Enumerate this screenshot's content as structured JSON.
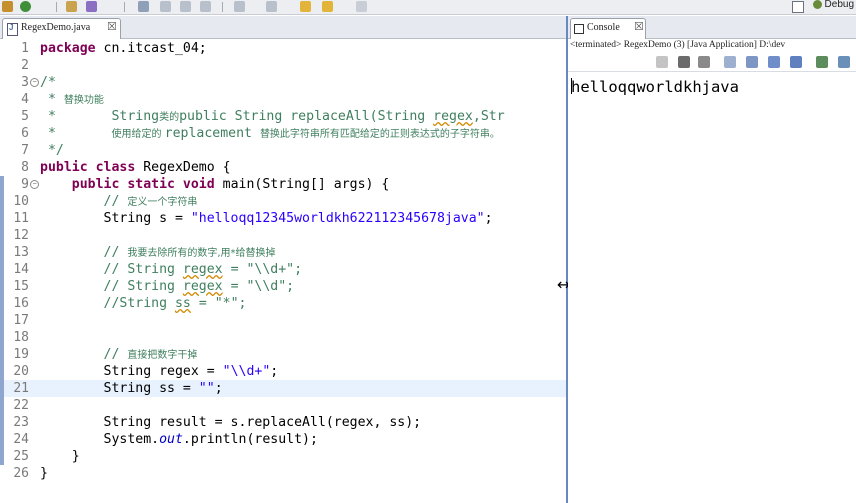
{
  "editor": {
    "tab_label": "RegexDemo.java",
    "close_glyph": "☒",
    "current_line": 21,
    "lines": [
      {
        "n": "1",
        "mark": false,
        "fold": "",
        "tokens": [
          {
            "t": "package",
            "c": "kw"
          },
          {
            "t": " cn.itcast_04;",
            "c": ""
          }
        ]
      },
      {
        "n": "2",
        "mark": false,
        "fold": "",
        "tokens": []
      },
      {
        "n": "3",
        "mark": false,
        "fold": "−",
        "tokens": [
          {
            "t": "/*",
            "c": "cm"
          }
        ]
      },
      {
        "n": "4",
        "mark": false,
        "fold": "",
        "tokens": [
          {
            "t": " * ",
            "c": "cm"
          },
          {
            "t": "替换功能",
            "c": "cmc"
          }
        ]
      },
      {
        "n": "5",
        "mark": false,
        "fold": "",
        "tokens": [
          {
            "t": " *       String",
            "c": "cm"
          },
          {
            "t": "类的",
            "c": "cmc"
          },
          {
            "t": "public String replaceAll(String ",
            "c": "cm"
          },
          {
            "t": "regex",
            "c": "cm sq"
          },
          {
            "t": ",Str",
            "c": "cm"
          }
        ]
      },
      {
        "n": "6",
        "mark": false,
        "fold": "",
        "tokens": [
          {
            "t": " *       ",
            "c": "cm"
          },
          {
            "t": "使用给定的 ",
            "c": "cmc"
          },
          {
            "t": "replacement ",
            "c": "cm"
          },
          {
            "t": "替换此字符串所有匹配给定的正则表达式的子字符串。",
            "c": "cmc"
          }
        ]
      },
      {
        "n": "7",
        "mark": false,
        "fold": "",
        "tokens": [
          {
            "t": " */",
            "c": "cm"
          }
        ]
      },
      {
        "n": "8",
        "mark": false,
        "fold": "",
        "tokens": [
          {
            "t": "public class",
            "c": "kw"
          },
          {
            "t": " RegexDemo {",
            "c": ""
          }
        ]
      },
      {
        "n": "9",
        "mark": true,
        "fold": "−",
        "tokens": [
          {
            "t": "    ",
            "c": ""
          },
          {
            "t": "public static void",
            "c": "kw"
          },
          {
            "t": " main(String[] args) {",
            "c": ""
          }
        ]
      },
      {
        "n": "10",
        "mark": true,
        "fold": "",
        "tokens": [
          {
            "t": "        // ",
            "c": "cm"
          },
          {
            "t": "定义一个字符串",
            "c": "cmc"
          }
        ]
      },
      {
        "n": "11",
        "mark": true,
        "fold": "",
        "tokens": [
          {
            "t": "        String s = ",
            "c": ""
          },
          {
            "t": "\"helloqq12345worldkh622112345678java\"",
            "c": "st"
          },
          {
            "t": ";",
            "c": ""
          }
        ]
      },
      {
        "n": "12",
        "mark": true,
        "fold": "",
        "tokens": []
      },
      {
        "n": "13",
        "mark": true,
        "fold": "",
        "tokens": [
          {
            "t": "        // ",
            "c": "cm"
          },
          {
            "t": "我要去除所有的数字,用*给替换掉",
            "c": "cmc"
          }
        ]
      },
      {
        "n": "14",
        "mark": true,
        "fold": "",
        "tokens": [
          {
            "t": "        // String ",
            "c": "cm"
          },
          {
            "t": "regex",
            "c": "cm sq"
          },
          {
            "t": " = \"\\\\d+\";",
            "c": "cm"
          }
        ]
      },
      {
        "n": "15",
        "mark": true,
        "fold": "",
        "tokens": [
          {
            "t": "        // String ",
            "c": "cm"
          },
          {
            "t": "regex",
            "c": "cm sq"
          },
          {
            "t": " = \"\\\\d\";",
            "c": "cm"
          }
        ]
      },
      {
        "n": "16",
        "mark": true,
        "fold": "",
        "tokens": [
          {
            "t": "        //String ",
            "c": "cm"
          },
          {
            "t": "ss",
            "c": "cm sq"
          },
          {
            "t": " = \"*\";",
            "c": "cm"
          }
        ]
      },
      {
        "n": "17",
        "mark": true,
        "fold": "",
        "tokens": []
      },
      {
        "n": "18",
        "mark": true,
        "fold": "",
        "tokens": []
      },
      {
        "n": "19",
        "mark": true,
        "fold": "",
        "tokens": [
          {
            "t": "        // ",
            "c": "cm"
          },
          {
            "t": "直接把数字干掉",
            "c": "cmc"
          }
        ]
      },
      {
        "n": "20",
        "mark": true,
        "fold": "",
        "tokens": [
          {
            "t": "        String regex = ",
            "c": ""
          },
          {
            "t": "\"\\\\d+\"",
            "c": "st"
          },
          {
            "t": ";",
            "c": ""
          }
        ]
      },
      {
        "n": "21",
        "mark": true,
        "fold": "",
        "tokens": [
          {
            "t": "        String ss = ",
            "c": ""
          },
          {
            "t": "\"\"",
            "c": "st"
          },
          {
            "t": ";",
            "c": ""
          }
        ]
      },
      {
        "n": "22",
        "mark": true,
        "fold": "",
        "tokens": []
      },
      {
        "n": "23",
        "mark": true,
        "fold": "",
        "tokens": [
          {
            "t": "        String result = s.replaceAll(regex, ss);",
            "c": ""
          }
        ]
      },
      {
        "n": "24",
        "mark": true,
        "fold": "",
        "tokens": [
          {
            "t": "        System.",
            "c": ""
          },
          {
            "t": "out",
            "c": "fld"
          },
          {
            "t": ".println(result);",
            "c": ""
          }
        ]
      },
      {
        "n": "25",
        "mark": true,
        "fold": "",
        "tokens": [
          {
            "t": "    }",
            "c": ""
          }
        ]
      },
      {
        "n": "26",
        "mark": false,
        "fold": "",
        "tokens": [
          {
            "t": "}",
            "c": ""
          }
        ]
      }
    ]
  },
  "console": {
    "tab_label": "Console",
    "status": "<terminated> RegexDemo (3) [Java Application] D:\\dev",
    "output": "helloqqworldkhjava"
  },
  "toolbar": {
    "debug_label": "Debug"
  },
  "colors": {
    "keyword": "#7f0055",
    "comment": "#3f7f5f",
    "string": "#2a00ff",
    "change_ruler": "#8fa6cf",
    "current_line": "#e8f2fe"
  }
}
